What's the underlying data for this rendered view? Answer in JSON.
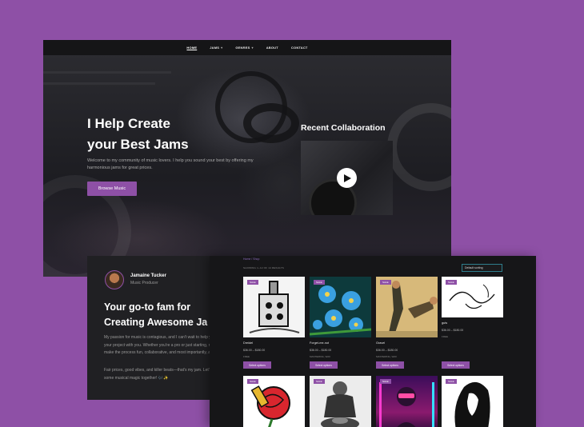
{
  "nav": {
    "items": [
      {
        "label": "HOME",
        "has_dropdown": false,
        "active": true
      },
      {
        "label": "JAMS",
        "has_dropdown": true,
        "active": false
      },
      {
        "label": "GENRES",
        "has_dropdown": true,
        "active": false
      },
      {
        "label": "ABOUT",
        "has_dropdown": false,
        "active": false
      },
      {
        "label": "CONTACT",
        "has_dropdown": false,
        "active": false
      }
    ],
    "chevron": "▾"
  },
  "hero": {
    "title": "I Help Create\nyour Best Jams",
    "text": "Welcome to my community of music lovers. I help you sound your best by offering my harmonious jams for great prices.",
    "button_label": "Browse Music"
  },
  "collab": {
    "title": "Recent Collaboration",
    "play_icon": "play-icon"
  },
  "profile": {
    "name": "Jamaine Tucker",
    "role": "Music Producer",
    "heading": "Your go-to fam for\nCreating Awesome Ja",
    "p1": "My passion for music is contagious, and I can't wait to help you with your project with you. Whether you're a pro or just starting, my goal is to make the process fun, collaborative, and most importantly, all about you.",
    "p2": "Fair prices, good vibes, and killer beats—that's my jam. Let's create some musical magic together! 🎶✨"
  },
  "shop": {
    "breadcrumb": "Home / Shop",
    "result_count": "SHOWING 1–12 OF 14 RESULTS",
    "sort_label": "Default sorting",
    "products": [
      {
        "title": "Dreidel",
        "price": "$36.00 – $180.00",
        "license": "FREE",
        "button": "Select options",
        "badge": "SALE",
        "art": "dreidel"
      },
      {
        "title": "Forget-me-not",
        "price": "$36.00 – $180.00",
        "license": "MASTERING, WAV",
        "button": "Select options",
        "badge": "SALE",
        "art": "flowers"
      },
      {
        "title": "Gravel",
        "price": "$36.00 – $180.00",
        "license": "MASTERING, WAV",
        "button": "Select options",
        "badge": "SALE",
        "art": "fight"
      },
      {
        "title": "guts",
        "price": "$36.00 – $180.00",
        "license": "FREE",
        "button": "Select options",
        "badge": "SALE",
        "art": "sketch"
      },
      {
        "title": "",
        "price": "",
        "license": "",
        "button": "",
        "badge": "SALE",
        "art": "rose"
      },
      {
        "title": "",
        "price": "",
        "license": "",
        "button": "",
        "badge": "SALE",
        "art": "potter"
      },
      {
        "title": "",
        "price": "",
        "license": "",
        "button": "",
        "badge": "SALE",
        "art": "neon"
      },
      {
        "title": "",
        "price": "",
        "license": "",
        "button": "",
        "badge": "SALE",
        "art": "portrait"
      }
    ]
  },
  "colors": {
    "background": "#8e50a6",
    "accent": "#8e50a6",
    "site_bg": "#1a1a1c",
    "select_border": "#2f7d8c"
  }
}
